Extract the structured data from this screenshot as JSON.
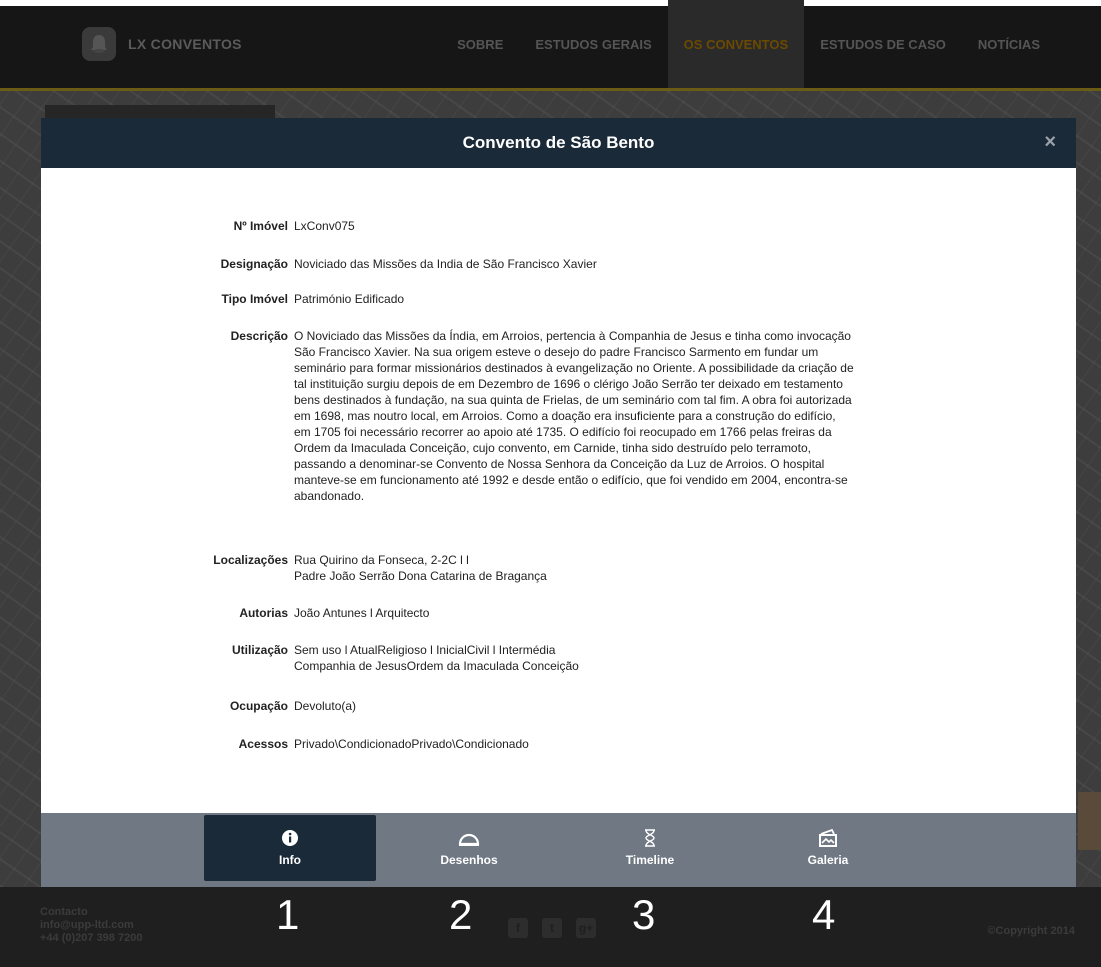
{
  "topbar": {
    "logo_text": "LX CONVENTOS",
    "nav": [
      {
        "label": "SOBRE",
        "active": false
      },
      {
        "label": "ESTUDOS GERAIS",
        "active": false
      },
      {
        "label": "OS CONVENTOS",
        "active": true
      },
      {
        "label": "ESTUDOS DE CASO",
        "active": false
      },
      {
        "label": "NOTÍCIAS",
        "active": false
      }
    ]
  },
  "modal": {
    "title": "Convento de São Bento",
    "close_label": "×",
    "fields": [
      {
        "label": "Nº Imóvel",
        "lines": [
          "LxConv075"
        ]
      },
      {
        "label": "Designação",
        "lines": [
          "Noviciado das Missões da India de São Francisco Xavier"
        ]
      },
      {
        "label": "Tipo Imóvel",
        "lines": [
          "Património Edificado"
        ]
      },
      {
        "label": "Descrição",
        "lines": [
          "O Noviciado das Missões da Índia, em Arroios, pertencia à Companhia de Jesus e tinha como invocação",
          "São Francisco Xavier. Na sua origem esteve o desejo do padre Francisco Sarmento em fundar um",
          "seminário para formar missionários destinados à evangelização no Oriente. A possibilidade da criação de",
          "tal instituição surgiu depois de em Dezembro de 1696 o clérigo João Serrão ter deixado em testamento",
          "bens destinados à fundação, na sua quinta de Frielas, de um seminário com tal fim. A obra foi autorizada",
          "em 1698, mas noutro local, em Arroios. Como a doação era insuficiente para a construção do edifício,",
          "em 1705 foi necessário recorrer ao apoio até 1735. O edifício foi reocupado em 1766 pelas freiras da",
          "Ordem da Imaculada Conceição, cujo convento, em Carnide, tinha sido destruído pelo terramoto,",
          "passando a denominar-se Convento de Nossa Senhora da Conceição da Luz de Arroios. O hospital",
          "manteve-se em funcionamento até 1992 e desde então o edifício, que foi vendido em 2004, encontra-se",
          "abandonado."
        ]
      },
      {
        "label": "Localizações",
        "lines": [
          "Rua Quirino da Fonseca, 2-2C l l",
          "Padre João Serrão Dona Catarina de Bragança"
        ]
      },
      {
        "label": "Autorias",
        "lines": [
          "João Antunes l Arquitecto"
        ]
      },
      {
        "label": "Utilização",
        "lines": [
          "Sem uso l AtualReligioso l InicialCivil l Intermédia",
          "Companhia de JesusOrdem da Imaculada Conceição"
        ]
      },
      {
        "label": "Ocupação",
        "lines": [
          "Devoluto(a)"
        ]
      },
      {
        "label": "Acessos",
        "lines": [
          "Privado\\CondicionadoPrivado\\Condicionado"
        ]
      }
    ],
    "tabs": [
      {
        "label": "Info",
        "icon": "info-icon",
        "active": true
      },
      {
        "label": "Desenhos",
        "icon": "protractor-icon",
        "active": false
      },
      {
        "label": "Timeline",
        "icon": "hourglass-icon",
        "active": false
      },
      {
        "label": "Galeria",
        "icon": "gallery-icon",
        "active": false
      }
    ]
  },
  "footer": {
    "contact_title": "Contacto",
    "email": "info@upp-ltd.com",
    "phone": "+44 (0)207 398 7200",
    "copyright": "©Copyright 2014",
    "social_glyphs": [
      "f",
      "t",
      "g+"
    ]
  },
  "annotations": [
    "1",
    "2",
    "3",
    "4"
  ]
}
